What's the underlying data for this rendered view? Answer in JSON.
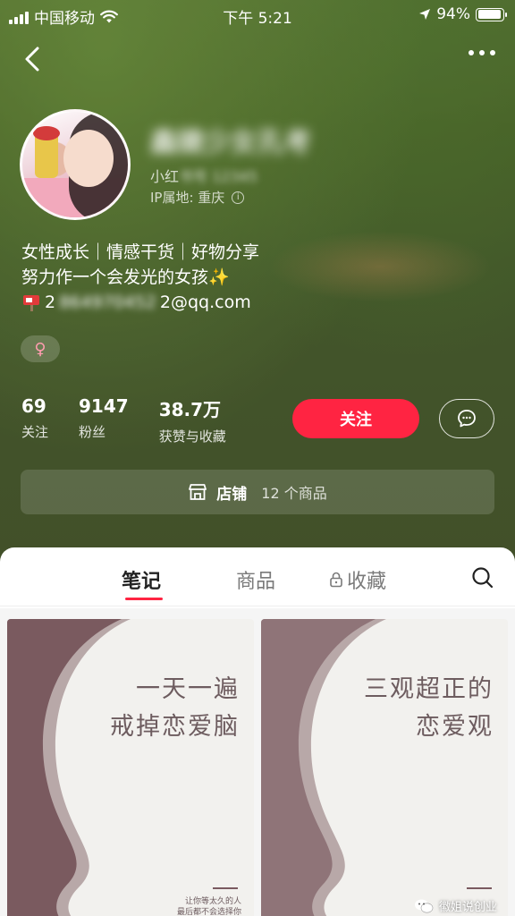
{
  "status_bar": {
    "carrier": "中国移动",
    "time": "下午 5:21",
    "battery": "94%",
    "battery_level": 0.94
  },
  "profile": {
    "name_blurred": "鑫婕少女孔考",
    "id_prefix": "小红",
    "id_blurred": "书号 12345",
    "ip_location": "IP属地: 重庆",
    "bio_line1": "女性成长｜情感干货｜好物分享",
    "bio_line2": "努力作一个会发光的女孩✨",
    "email_prefix": "2",
    "email_blurred": "864970452",
    "email_suffix": "2@qq.com",
    "gender_symbol": "♀"
  },
  "stats": [
    {
      "value": "69",
      "label": "关注"
    },
    {
      "value": "9147",
      "label": "粉丝"
    },
    {
      "value": "38.7万",
      "label": "获赞与收藏"
    }
  ],
  "actions": {
    "follow_label": "关注"
  },
  "shop": {
    "label": "店铺",
    "count": "12 个商品"
  },
  "tabs": {
    "notes": "笔记",
    "products": "商品",
    "favorites": "收藏"
  },
  "cards": [
    {
      "title_line1": "一天一遍",
      "title_line2": "戒掉恋爱脑",
      "small_line1": "让你等太久的人",
      "small_line2": "最后都不会选择你"
    },
    {
      "title_line1": "三观超正的",
      "title_line2": "恋爱观"
    }
  ],
  "watermark": "徽姐说创业",
  "colors": {
    "accent": "#ff2442",
    "card_curve": "#7a5a5f",
    "card_text": "#6d5c5f"
  }
}
